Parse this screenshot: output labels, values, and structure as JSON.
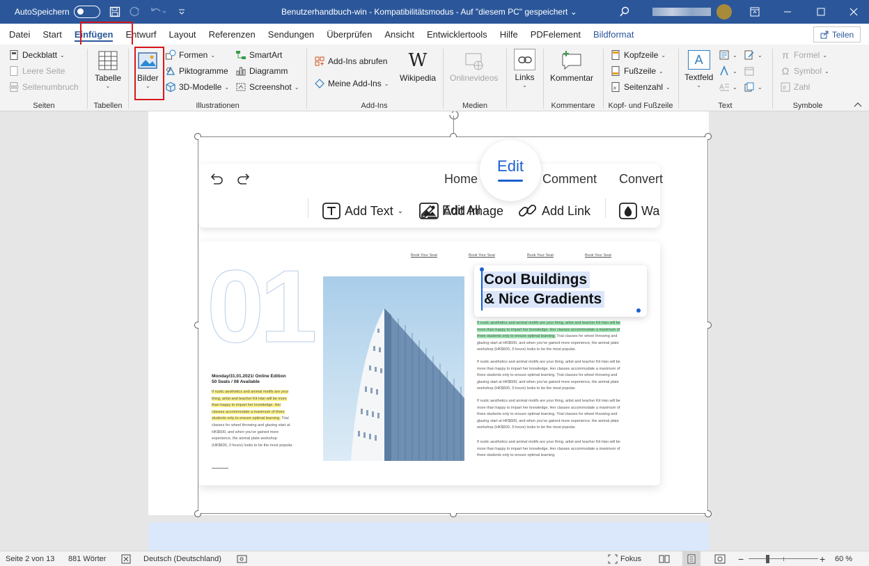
{
  "titlebar": {
    "autosave_label": "AutoSpeichern",
    "autosave_state": "Aus",
    "document_title": "Benutzerhandbuch-win  -  Kompatibilitätsmodus  -  Auf \"diesem PC\" gespeichert  ⌄",
    "accent_color": "#2b579a"
  },
  "tabs": [
    {
      "label": "Datei"
    },
    {
      "label": "Start"
    },
    {
      "label": "Einfügen",
      "active": true
    },
    {
      "label": "Entwurf"
    },
    {
      "label": "Layout"
    },
    {
      "label": "Referenzen"
    },
    {
      "label": "Sendungen"
    },
    {
      "label": "Überprüfen"
    },
    {
      "label": "Ansicht"
    },
    {
      "label": "Entwicklertools"
    },
    {
      "label": "Hilfe"
    },
    {
      "label": "PDFelement"
    },
    {
      "label": "Bildformat"
    }
  ],
  "share_label": "Teilen",
  "ribbon": {
    "seiten": {
      "label": "Seiten",
      "deckblatt": "Deckblatt",
      "leere_seite": "Leere Seite",
      "seitenumbruch": "Seitenumbruch"
    },
    "tabellen": {
      "label": "Tabellen",
      "tabelle": "Tabelle"
    },
    "illustrationen": {
      "label": "Illustrationen",
      "bilder": "Bilder",
      "formen": "Formen",
      "piktogramme": "Piktogramme",
      "modelle": "3D-Modelle",
      "smartart": "SmartArt",
      "diagramm": "Diagramm",
      "screenshot": "Screenshot"
    },
    "addins": {
      "label": "Add-Ins",
      "abrufen": "Add-Ins abrufen",
      "meine": "Meine Add-Ins",
      "wikipedia": "Wikipedia"
    },
    "medien": {
      "label": "Medien",
      "onlinevideos": "Onlinevideos"
    },
    "links": {
      "label": "Links"
    },
    "kommentare": {
      "label": "Kommentare",
      "kommentar": "Kommentar"
    },
    "kopf": {
      "label": "Kopf- und Fußzeile",
      "kopfzeile": "Kopfzeile",
      "fusszeile": "Fußzeile",
      "seitenzahl": "Seitenzahl"
    },
    "text": {
      "label": "Text",
      "textfeld": "Textfeld"
    },
    "symbole": {
      "label": "Symbole",
      "formel": "Formel",
      "symbol": "Symbol",
      "zahl": "Zahl"
    }
  },
  "embedded": {
    "nav": [
      "Home",
      "Edit",
      "Comment",
      "Convert"
    ],
    "tools": [
      "Edit All",
      "Add Text",
      "Add Image",
      "Add Link",
      "Wa"
    ],
    "book_links": [
      "Book Your Seat",
      "Book Your Seat",
      "Book Your Seat",
      "Book Your Seat"
    ],
    "big_number": "01",
    "heading_line1": "Cool Buildings",
    "heading_line2": "& Nice Gradients",
    "event_line1": "Monday/31.01.2021/ Online Edition",
    "event_line2": "50 Seats / 08 Available",
    "left_highlight": [
      "If rustic aesthetics and animal motifs are your",
      "thing, artist and teacher Kit Han will be more",
      "than happy to impart her knowledge. Her",
      "classes accommodate a maximum of three",
      "students only to ensure optimal learning."
    ],
    "left_trailing": "Trial",
    "left_rest": [
      "classes for wheel throwing and glazing start at",
      "HK$600, and when you've gained more",
      "experience, the animal plate workshop",
      "(HK$600, 3 hours) looks to be the most popular."
    ],
    "right_highlight": [
      "If rustic aesthetics and animal motifs are your thing, artist and teacher Kit Han will be",
      "more than happy to impart her knowledge. Her classes accommodate a maximum of",
      "three students only to ensure optimal learning."
    ],
    "right_trailing": "Trial classes for wheel throwing and",
    "right_rest1": [
      "glazing start at HK$600, and when you've gained more experience, the animal plate",
      "workshop (HK$600, 3 hours) looks to be the most popular."
    ],
    "para": [
      "If rustic aesthetics and animal motifs are your thing, artist and teacher Kit Han will be",
      "more than happy to impart her knowledge. Her classes accommodate a maximum of",
      "three students only to ensure optimal learning. Trial classes for wheel throwing and",
      "glazing start at HK$600, and when you've gained more experience, the animal plate",
      "workshop (HK$600, 3 hours) looks to be the most popular."
    ],
    "para_last": [
      "If rustic aesthetics and animal motifs are your thing, artist and teacher Kit Han will be",
      "more than happy to impart her knowledge. Her classes accommodate a maximum of",
      "three students only to ensure optimal learning."
    ]
  },
  "status": {
    "page": "Seite 2 von 13",
    "words": "881 Wörter",
    "language": "Deutsch (Deutschland)",
    "focus": "Fokus",
    "zoom": "60 %",
    "zoom_percent": 60
  }
}
